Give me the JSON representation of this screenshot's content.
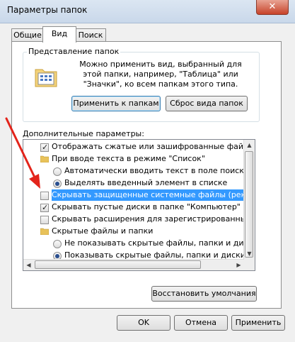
{
  "window": {
    "title": "Параметры папок",
    "close_glyph": "✕"
  },
  "tabs": [
    {
      "label": "Общие",
      "active": false
    },
    {
      "label": "Вид",
      "active": true
    },
    {
      "label": "Поиск",
      "active": false
    }
  ],
  "folder_view": {
    "group_title": "Представление папок",
    "description": "Можно применить вид, выбранный для этой папки, например, \"Таблица\" или \"Значки\", ко всем папкам этого типа.",
    "apply_button": "Применить к папкам",
    "reset_button": "Сброс вида папок"
  },
  "advanced": {
    "label": "Дополнительные параметры:",
    "items": [
      {
        "type": "checkbox",
        "level": 0,
        "checked": true,
        "label": "Отображать сжатые или зашифрованные файлы NTFS"
      },
      {
        "type": "folder",
        "level": 0,
        "label": "При вводе текста в режиме \"Список\""
      },
      {
        "type": "radio",
        "level": 1,
        "checked": false,
        "label": "Автоматически вводить текст в поле поиска"
      },
      {
        "type": "radio",
        "level": 1,
        "checked": true,
        "label": "Выделять введенный элемент в списке"
      },
      {
        "type": "checkbox",
        "level": 0,
        "checked": false,
        "selected": true,
        "label": "Скрывать защищенные системные файлы (рекомендуется)"
      },
      {
        "type": "checkbox",
        "level": 0,
        "checked": true,
        "label": "Скрывать пустые диски в папке \"Компьютер\""
      },
      {
        "type": "checkbox",
        "level": 0,
        "checked": false,
        "label": "Скрывать расширения для зарегистрированных типов файлов"
      },
      {
        "type": "folder",
        "level": 0,
        "label": "Скрытые файлы и папки"
      },
      {
        "type": "radio",
        "level": 1,
        "checked": false,
        "label": "Не показывать скрытые файлы, папки и диски"
      },
      {
        "type": "radio",
        "level": 1,
        "checked": true,
        "label": "Показывать скрытые файлы, папки и диски"
      }
    ]
  },
  "restore_button": "Восстановить умолчания",
  "dialog_buttons": {
    "ok": "OK",
    "cancel": "Отмена",
    "apply": "Применить"
  },
  "colors": {
    "annotation_arrow": "#e3241b",
    "selection": "#3399ff"
  }
}
